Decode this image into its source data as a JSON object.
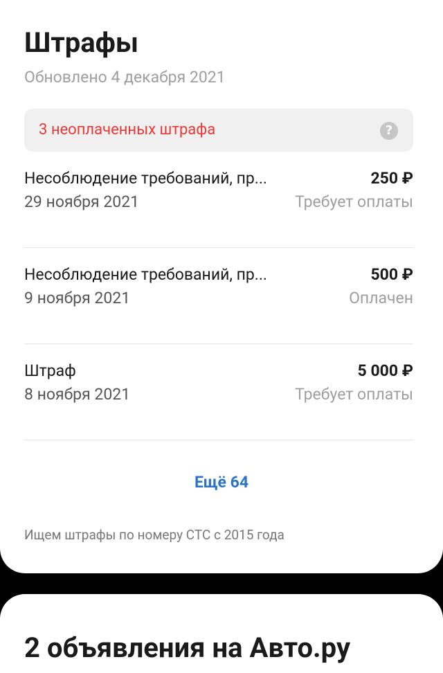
{
  "fines_card": {
    "title": "Штрафы",
    "updated": "Обновлено 4 декабря 2021",
    "unpaid_banner": {
      "text": "3 неоплаченных штрафа",
      "help_glyph": "?",
      "help_icon": "question-circle-icon"
    },
    "items": [
      {
        "title": "Несоблюдение требований, пр...",
        "amount": "250 ₽",
        "date": "29 ноября 2021",
        "status": "Требует оплаты"
      },
      {
        "title": "Несоблюдение требований, пр...",
        "amount": "500 ₽",
        "date": "9 ноября 2021",
        "status": "Оплачен"
      },
      {
        "title": "Штраф",
        "amount": "5 000 ₽",
        "date": "8 ноября 2021",
        "status": "Требует оплаты"
      }
    ],
    "more_label": "Ещё 64",
    "search_note": "Ищем штрафы по номеру СТС с 2015 года"
  },
  "ads_card": {
    "title": "2 объявления на Авто.ру"
  },
  "colors": {
    "background": "#000000",
    "card": "#ffffff",
    "unpaid_text": "#e53935",
    "link": "#2b73c4",
    "muted": "#9e9e9e",
    "banner": "#f0f0f0"
  }
}
